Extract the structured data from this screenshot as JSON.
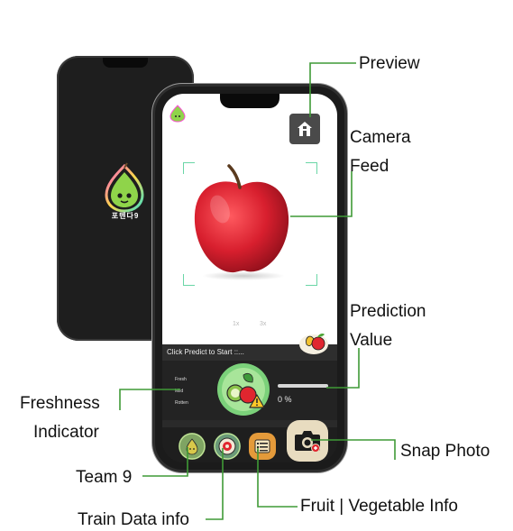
{
  "back_phone": {
    "logo_text": "포텐다9"
  },
  "app": {
    "predict_prompt": "Click Predict to Start ::...",
    "zoom_options": [
      "1x",
      "3x"
    ],
    "freshness_levels": [
      "Fresh",
      "Mild",
      "Rotten"
    ],
    "prediction_value": "0 %"
  },
  "callouts": {
    "preview": "Preview",
    "camera_feed_line1": "Camera",
    "camera_feed_line2": "Feed",
    "prediction_value_line1": "Prediction",
    "prediction_value_line2": "Value",
    "freshness_line1": "Freshness",
    "freshness_line2": "Indicator",
    "snap_photo": "Snap Photo",
    "team9": "Team 9",
    "fruit_vegetable_info": "Fruit | Vegetable Info",
    "train_data_info": "Train Data info"
  },
  "colors": {
    "leader_line": "#3f9a36",
    "accent_green": "#7bd17a",
    "snap_button": "#e8dcc0"
  },
  "icons": {
    "preview": "house-icon",
    "team9": "pear-icon",
    "train_data": "target-icon",
    "fruit_info": "list-icon",
    "snap": "camera-icon"
  }
}
